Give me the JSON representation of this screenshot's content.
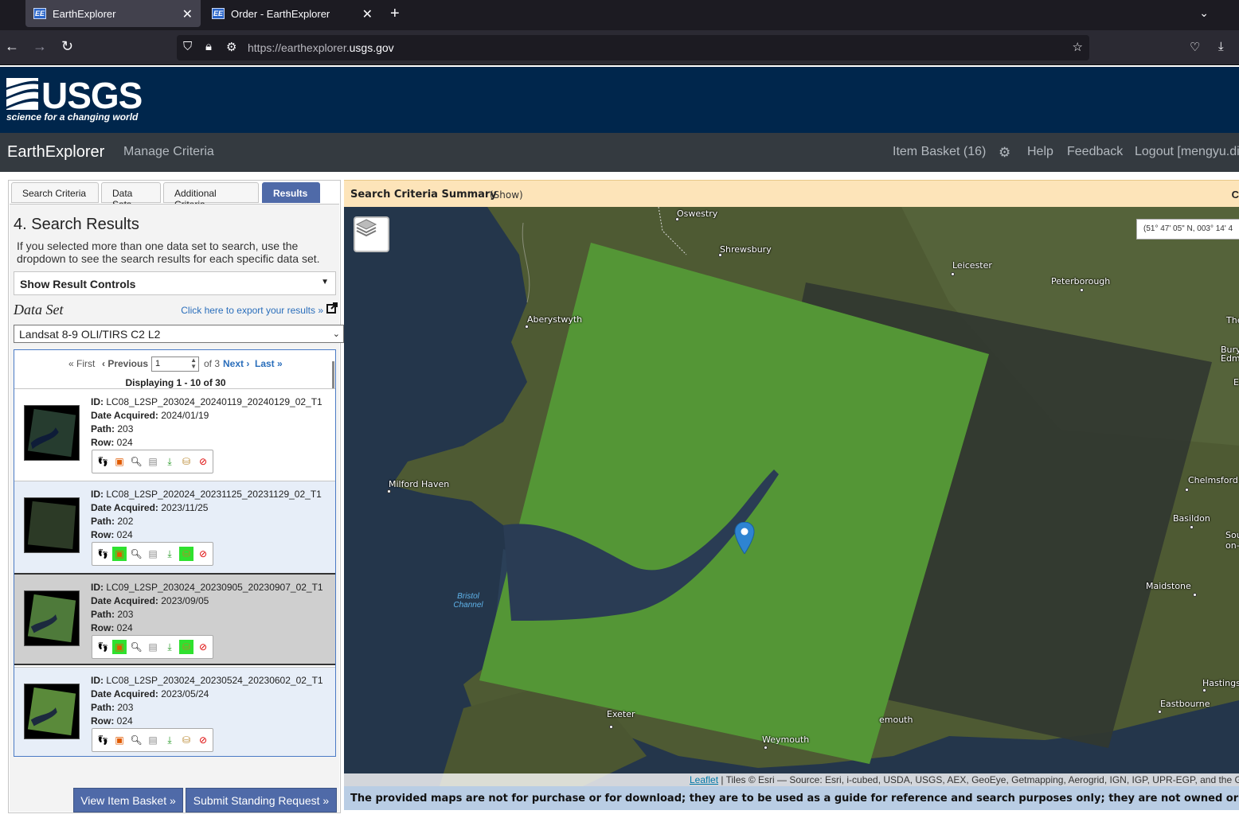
{
  "browser": {
    "tabs": [
      {
        "label": "EarthExplorer",
        "favicon": "EE"
      },
      {
        "label": "Order - EarthExplorer",
        "favicon": "EE"
      }
    ],
    "url_prefix": "https://earthexplorer.",
    "url_host": "usgs.gov"
  },
  "header": {
    "logo_text": "USGS",
    "tagline": "science for a changing world"
  },
  "appnav": {
    "title": "EarthExplorer",
    "manage": "Manage Criteria",
    "item_basket": "Item Basket (16)",
    "help": "Help",
    "feedback": "Feedback",
    "logout": "Logout [mengyu.di"
  },
  "panel": {
    "tabs": [
      "Search Criteria",
      "Data Sets",
      "Additional Criteria",
      "Results"
    ],
    "heading": "4. Search Results",
    "help_text": "If you selected more than one data set to search, use the dropdown to see the search results for each specific data set.",
    "result_controls": "Show Result Controls",
    "dataset_label": "Data Set",
    "export_link": "Click here to export your results »",
    "dataset_selected": "Landsat 8-9 OLI/TIRS C2 L2",
    "pager": {
      "first": "« First",
      "previous": "‹ Previous",
      "page": "1",
      "of": "of 3",
      "next": "Next ›",
      "last": "Last »"
    },
    "displaying": "Displaying 1 - 10 of 30",
    "field_labels": {
      "id": "ID:",
      "date": "Date Acquired:",
      "path": "Path:",
      "row": "Row:"
    },
    "results": [
      {
        "id": "LC08_L2SP_203024_20240119_20240129_02_T1",
        "date": "2024/01/19",
        "path": "203",
        "row": "024"
      },
      {
        "id": "LC08_L2SP_202024_20231125_20231129_02_T1",
        "date": "2023/11/25",
        "path": "202",
        "row": "024"
      },
      {
        "id": "LC09_L2SP_203024_20230905_20230907_02_T1",
        "date": "2023/09/05",
        "path": "203",
        "row": "024"
      },
      {
        "id": "LC08_L2SP_203024_20230524_20230602_02_T1",
        "date": "2023/05/24",
        "path": "203",
        "row": "024"
      }
    ],
    "view_basket": "View Item Basket »",
    "standing_request": "Submit Standing Request »"
  },
  "map": {
    "criteria_title": "Search Criteria Summary",
    "criteria_show": "(Show)",
    "criteria_right": "C",
    "coords": "(51° 47' 05\" N, 003° 14' 4",
    "cities": [
      "Oswestry",
      "Shrewsbury",
      "Leicester",
      "Peterborough",
      "Aberystwyth",
      "Milford Haven",
      "Chelmsford",
      "Basildon",
      "Maidstone",
      "Exeter",
      "Weymouth",
      "Hastings",
      "Eastbourne",
      "emouth",
      "The",
      "Bury Edm",
      "Sou on-",
      "E"
    ],
    "seas": [
      "Bristol Channel"
    ],
    "attribution_link": "Leaflet",
    "attribution": " | Tiles © Esri — Source: Esri, i-cubed, USDA, USGS, AEX, GeoEye, Getmapping, Aerogrid, IGN, IGP, UPR-EGP, and the G",
    "disclaimer": "The provided maps are not for purchase or for download; they are to be used as a guide for reference and search purposes only; they are not owned or manage"
  },
  "colors": {
    "usgs_blue": "#00264c",
    "nav_dark": "#343a40",
    "accent": "#4f6aa8",
    "highlight": "#2fe12f"
  }
}
